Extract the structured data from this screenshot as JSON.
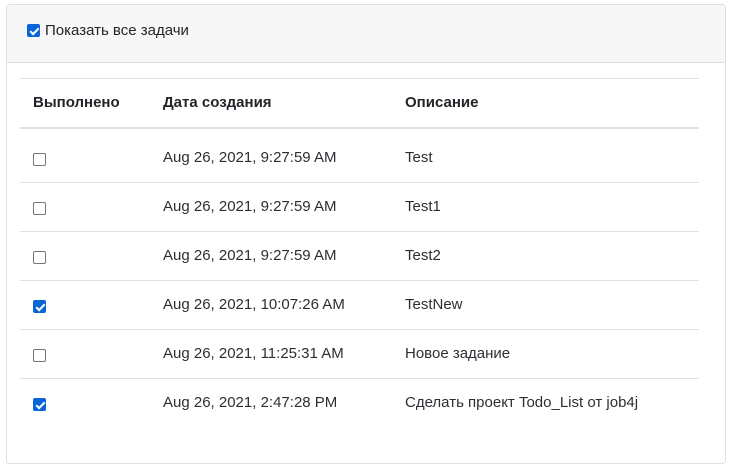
{
  "filter": {
    "label": "Показать все задачи",
    "checked": true
  },
  "table": {
    "headers": {
      "done": "Выполнено",
      "created": "Дата создания",
      "description": "Описание"
    },
    "rows": [
      {
        "done": false,
        "created": "Aug 26, 2021, 9:27:59 AM",
        "description": "Test"
      },
      {
        "done": false,
        "created": "Aug 26, 2021, 9:27:59 AM",
        "description": "Test1"
      },
      {
        "done": false,
        "created": "Aug 26, 2021, 9:27:59 AM",
        "description": "Test2"
      },
      {
        "done": true,
        "created": "Aug 26, 2021, 10:07:26 AM",
        "description": "TestNew"
      },
      {
        "done": false,
        "created": "Aug 26, 2021, 11:25:31 AM",
        "description": "Новое задание"
      },
      {
        "done": true,
        "created": "Aug 26, 2021, 2:47:28 PM",
        "description": "Сделать проект Todo_List от job4j"
      }
    ]
  },
  "colors": {
    "checkbox_accent": "#0a66d8",
    "header_background": "#f7f7f7",
    "border": "#dee2e6"
  }
}
